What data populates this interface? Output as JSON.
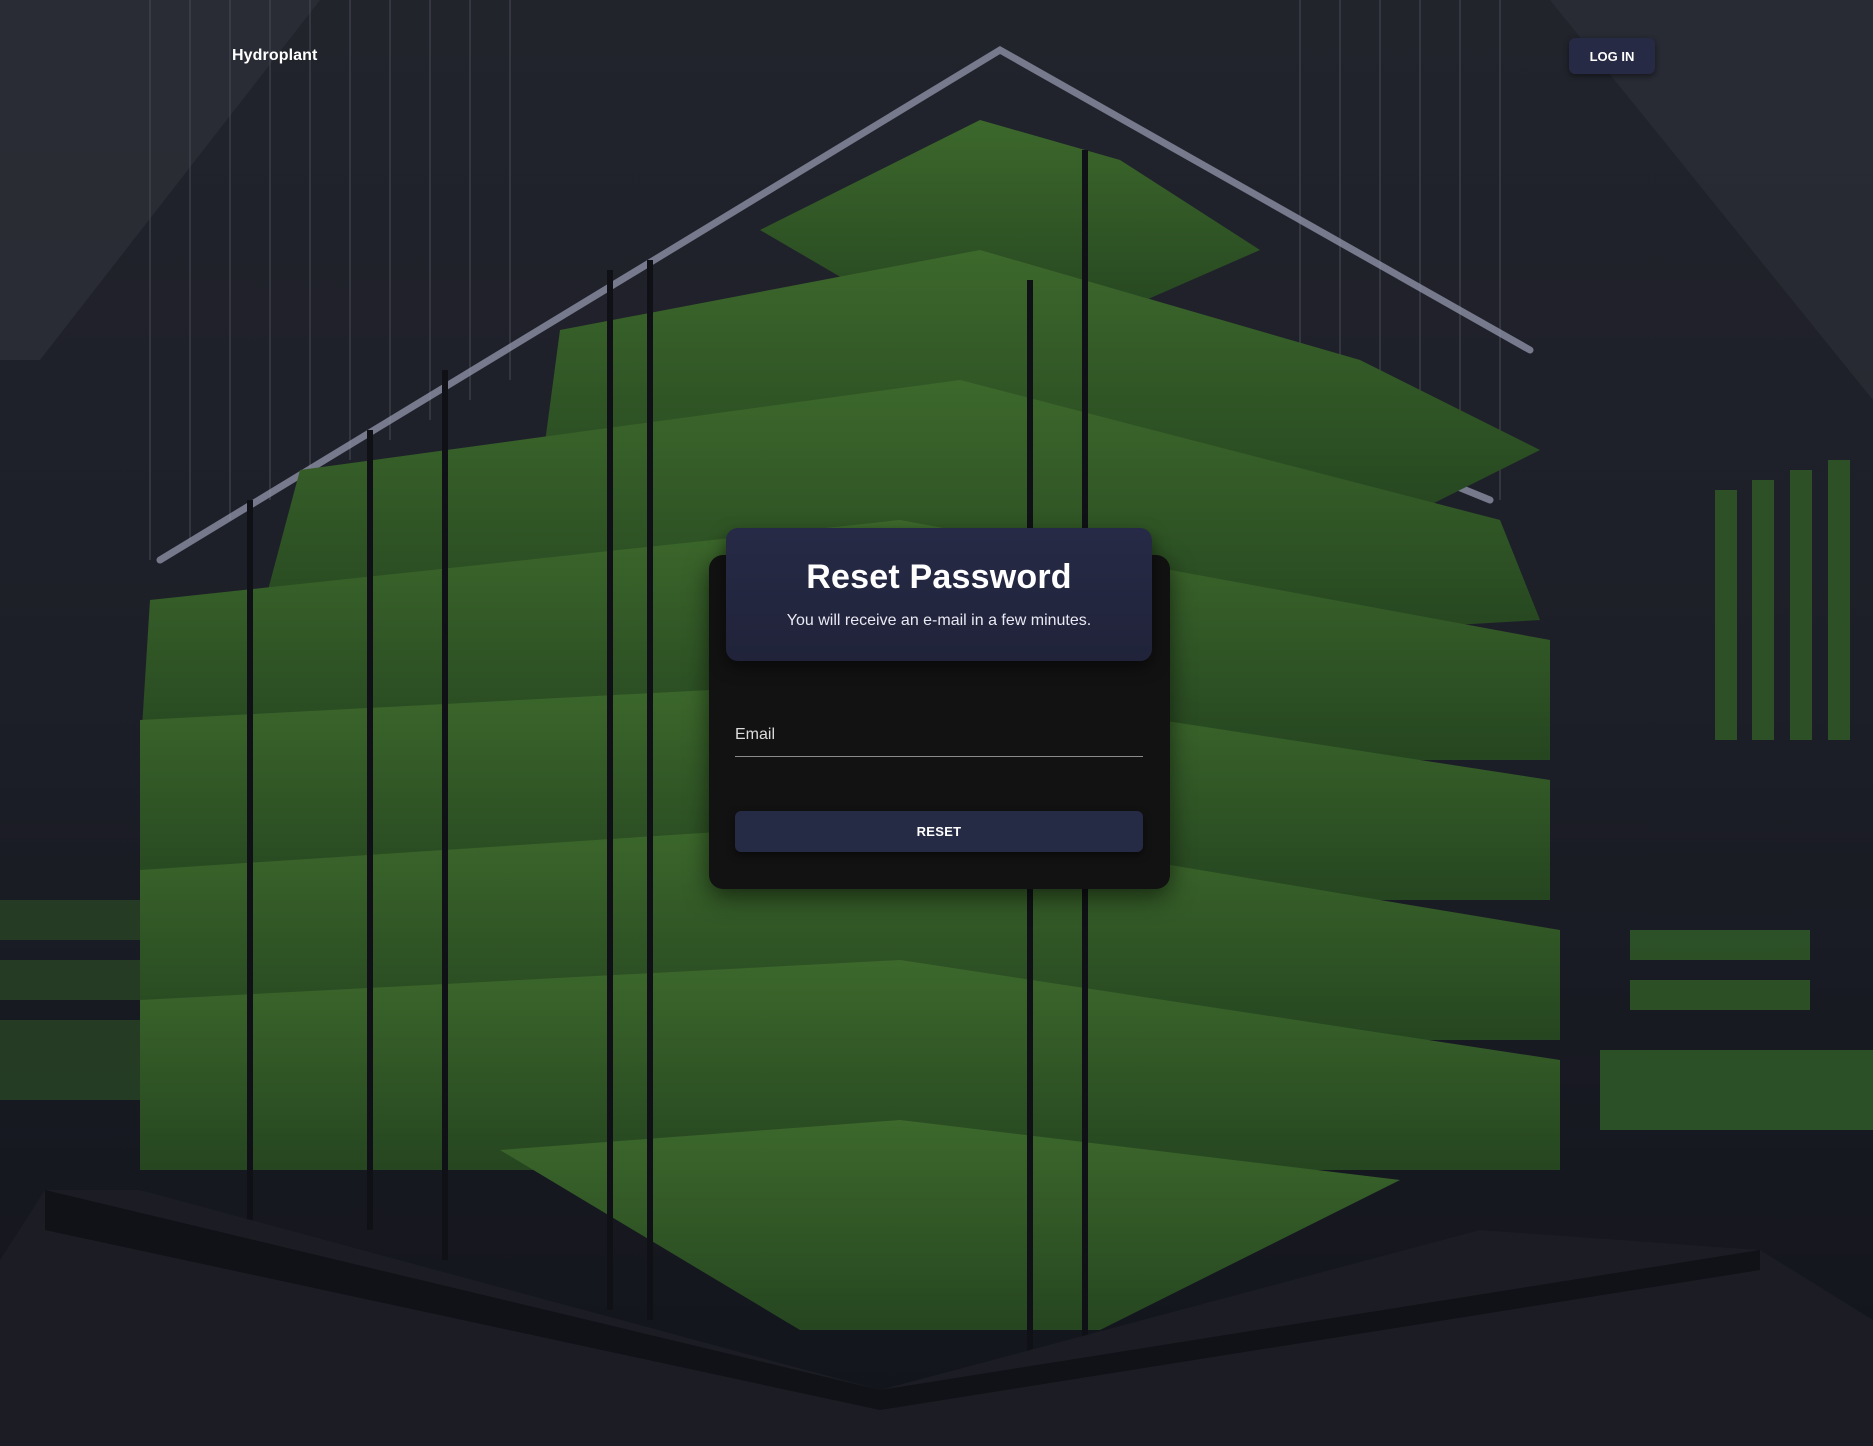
{
  "header": {
    "brand": "Hydroplant",
    "login_label": "LOG IN"
  },
  "reset_card": {
    "title": "Reset Password",
    "subtitle": "You will receive an e-mail in a few minutes.",
    "email_label": "Email",
    "email_value": "",
    "submit_label": "RESET"
  },
  "colors": {
    "accent": "#262a44",
    "card_background": "#121212",
    "page_overlay": "#1a1b24"
  }
}
